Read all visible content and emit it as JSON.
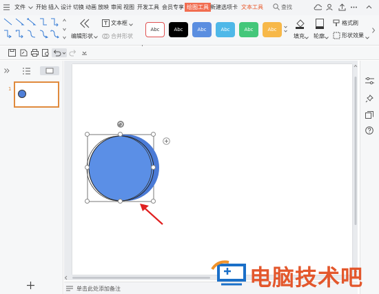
{
  "menubar": {
    "items": [
      "文件",
      "开始",
      "插入",
      "设计",
      "切换",
      "动画",
      "放映",
      "审阅",
      "视图",
      "开发工具",
      "会员专享",
      "绘图工具",
      "新建选项卡",
      "文本工具"
    ],
    "active_item": "绘图工具",
    "search_label": "查找"
  },
  "ribbon": {
    "edit_shape_label": "编辑形状",
    "textbox_label": "文本框",
    "merge_shape_label": "合并形状",
    "style_label": "Abc",
    "fill_label": "填充",
    "outline_label": "轮廓",
    "format_painter_label": "格式刷",
    "shape_effect_label": "形状效果",
    "style_colors": [
      "#ffffff",
      "#000000",
      "#5b8ee0",
      "#4fb8e8",
      "#44c77a",
      "#f7b849"
    ]
  },
  "left_panel": {
    "slide_number": "1"
  },
  "notes": {
    "placeholder": "单击此处添加备注"
  },
  "watermark": {
    "text": "电脑技术吧"
  },
  "colors": {
    "accent_orange": "#f16d50",
    "circle_fill": "#5b8fe6",
    "circle_shadow": "#4a7ad6",
    "arrow_red": "#e02020"
  }
}
